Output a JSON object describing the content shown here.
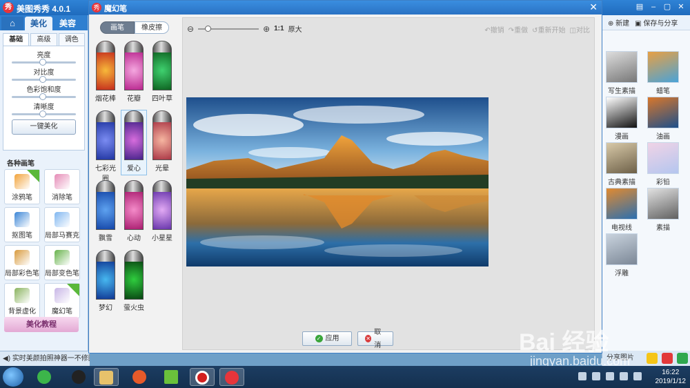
{
  "app": {
    "title": "美图秀秀 4.0.1",
    "logo": "秀"
  },
  "main_tabs": [
    "美化",
    "美容"
  ],
  "sub_tabs": [
    "基础",
    "高级",
    "调色"
  ],
  "adjustments": [
    {
      "label": "亮度",
      "level": 0.45
    },
    {
      "label": "对比度",
      "level": 0.45
    },
    {
      "label": "色彩饱和度",
      "level": 0.45
    },
    {
      "label": "清晰度",
      "level": 0.45
    }
  ],
  "one_click": "一键美化",
  "brush_section_title": "各种画笔",
  "brushes": [
    {
      "label": "涂鸦笔",
      "color": "#f2a33a",
      "badge": "升级"
    },
    {
      "label": "消除笔",
      "color": "#e58ab6"
    },
    {
      "label": "抠图笔",
      "color": "#3b85d6"
    },
    {
      "label": "局部马赛克",
      "color": "#7fb6f0"
    },
    {
      "label": "局部彩色笔",
      "color": "#d89a3c"
    },
    {
      "label": "局部变色笔",
      "color": "#66b24a"
    },
    {
      "label": "背景虚化",
      "color": "#89b35e"
    },
    {
      "label": "魔幻笔",
      "color": "#c8b6e6",
      "badge": "new"
    }
  ],
  "tutorial": "美化教程",
  "status_text": "实时美颜拍照神器一不修图",
  "right_toolbar": {
    "new": "新建",
    "save": "保存与分享"
  },
  "effects": [
    {
      "label": "写生素描",
      "colors": [
        "#ddd",
        "#777"
      ]
    },
    {
      "label": "蜡笔",
      "colors": [
        "#e8a044",
        "#4aa3d8"
      ]
    },
    {
      "label": "漫画",
      "colors": [
        "#fff",
        "#111"
      ]
    },
    {
      "label": "油画",
      "colors": [
        "#d9772b",
        "#1d4f8a"
      ]
    },
    {
      "label": "古典素描",
      "colors": [
        "#d8c9a8",
        "#6d6048"
      ]
    },
    {
      "label": "彩铅",
      "colors": [
        "#f0d3e6",
        "#b4c6ef"
      ]
    },
    {
      "label": "电视线",
      "colors": [
        "#e18a30",
        "#2b6fb0"
      ]
    },
    {
      "label": "素描",
      "colors": [
        "#e2e2e2",
        "#606060"
      ]
    },
    {
      "label": "浮雕",
      "colors": [
        "#c9d3de",
        "#7b8796"
      ]
    }
  ],
  "share_label": "分享图片",
  "dialog": {
    "title": "魔幻笔",
    "seg": [
      "画笔",
      "橡皮擦"
    ],
    "zoom_label": "1:1",
    "zoom_text": "原大",
    "history": [
      "撤销",
      "重做",
      "重新开始",
      "对比"
    ],
    "apply": "应用",
    "cancel": "取消"
  },
  "pens": [
    {
      "label": "烟花棒",
      "colors": [
        "#c0201a",
        "#f7b93a"
      ]
    },
    {
      "label": "花瓣",
      "colors": [
        "#b41b87",
        "#f4a7df"
      ]
    },
    {
      "label": "四叶草",
      "colors": [
        "#0a5a1b",
        "#3fd16f"
      ]
    },
    {
      "label": "七彩光圈",
      "colors": [
        "#1a2f9b",
        "#7b8cf2"
      ]
    },
    {
      "label": "爱心",
      "colors": [
        "#3b1d84",
        "#d76ddd"
      ],
      "selected": true
    },
    {
      "label": "光晕",
      "colors": [
        "#a42c3e",
        "#f6b6a1"
      ]
    },
    {
      "label": "飘雪",
      "colors": [
        "#0f3fa2",
        "#5ea2f0"
      ]
    },
    {
      "label": "心动",
      "colors": [
        "#a31468",
        "#f48bc9"
      ]
    },
    {
      "label": "小星星",
      "colors": [
        "#5d2ba5",
        "#e2aaf4"
      ]
    },
    {
      "label": "梦幻",
      "colors": [
        "#0b2d8c",
        "#47b8f0"
      ]
    },
    {
      "label": "萤火虫",
      "colors": [
        "#063a0f",
        "#2fcd3e"
      ]
    }
  ],
  "watermark": {
    "logo": "Bai 经验",
    "url": "jingyan.baidu.com"
  },
  "clock": {
    "time": "16:22",
    "date": "2019/1/12"
  },
  "accent": "#2f83d6"
}
